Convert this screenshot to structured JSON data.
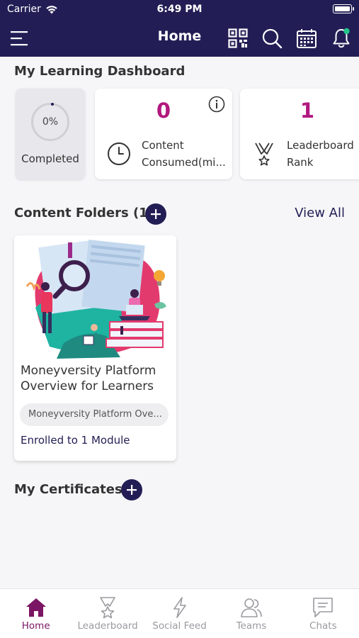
{
  "status_bar": {
    "carrier": "Carrier",
    "time": "6:49 PM"
  },
  "navbar": {
    "title": "Home",
    "icons": [
      "menu-icon",
      "qr-code-icon",
      "search-icon",
      "calendar-icon",
      "notification-bell-icon"
    ]
  },
  "dashboard": {
    "title": "My Learning Dashboard",
    "completed": {
      "value": "0%",
      "label": "Completed"
    },
    "content_consumed": {
      "value": "0",
      "label_line1": "Content",
      "label_line2": "Consumed(mi..."
    },
    "leaderboard_rank": {
      "value": "1",
      "label_line1": "Leaderboard",
      "label_line2": "Rank"
    }
  },
  "content_folders": {
    "title": "Content Folders (1)",
    "view_all": "View All",
    "items": [
      {
        "title": "Moneyversity Platform Overview for Learners",
        "chip": "Moneyversity Platform Ove...",
        "enrolled": "Enrolled to 1 Module"
      }
    ]
  },
  "certificates": {
    "title": "My Certificates"
  },
  "tabbar": {
    "items": [
      {
        "label": "Home",
        "icon": "home-icon",
        "active": true
      },
      {
        "label": "Leaderboard",
        "icon": "leaderboard-icon",
        "active": false
      },
      {
        "label": "Social Feed",
        "icon": "social-feed-icon",
        "active": false
      },
      {
        "label": "Teams",
        "icon": "teams-icon",
        "active": false
      },
      {
        "label": "Chats",
        "icon": "chats-icon",
        "active": false
      }
    ]
  },
  "colors": {
    "navbar": "#221e55",
    "accent_number": "#b1197f",
    "tab_active": "#7a1663",
    "tab_inactive": "#9a9aa0",
    "notification_dot": "#21c68b"
  }
}
